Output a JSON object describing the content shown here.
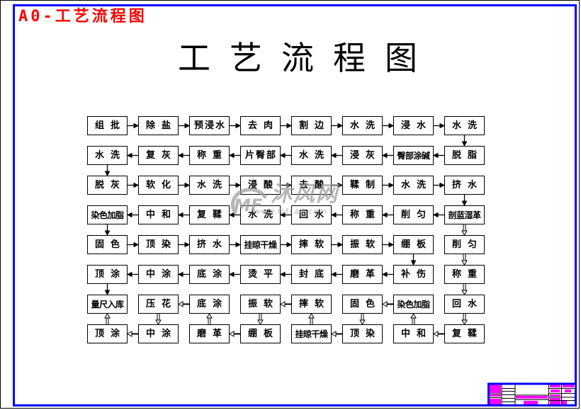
{
  "drawing": {
    "sheet_label": "A0-工艺流程图",
    "title": "工艺流程图"
  },
  "colors": {
    "frame": "#0000ff",
    "sheet_label": "#ff0000",
    "title_block_fill": "#ff00ff",
    "watermark": "#9a9a9a",
    "ink": "#000000"
  },
  "flowchart": {
    "rows": [
      [
        "组批",
        "除盐",
        "预浸水",
        "去肉",
        "割边",
        "水洗",
        "浸水",
        "水洗"
      ],
      [
        "水洗",
        "复灰",
        "称重",
        "片臀部",
        "水洗",
        "浸灰",
        "臀部涂碱",
        "脱脂"
      ],
      [
        "脱灰",
        "软化",
        "水洗",
        "浸酸",
        "去酸",
        "鞣制",
        "水洗",
        "挤水"
      ],
      [
        "染色加脂",
        "中和",
        "复鞣",
        "水洗",
        "回水",
        "称重",
        "削匀",
        "剖蓝湿革"
      ],
      [
        "固色",
        "顶染",
        "挤水",
        "挂晾干燥",
        "摔软",
        "振软",
        "绷板",
        "削匀"
      ],
      [
        "顶涂",
        "中涂",
        "底涂",
        "烫平",
        "封底",
        "磨革",
        "补伤",
        "称重"
      ],
      [
        "量尺入库",
        "压花",
        "底涂",
        "振软",
        "摔软",
        "固色",
        "染色加脂",
        "回水"
      ],
      [
        "顶涂",
        "中涂",
        "磨革",
        "绷板",
        "挂晾干燥",
        "顶染",
        "中和",
        "复鞣"
      ]
    ],
    "connections": [
      {
        "from": [
          0,
          0
        ],
        "to": [
          0,
          1
        ],
        "style": "solid"
      },
      {
        "from": [
          0,
          1
        ],
        "to": [
          0,
          2
        ],
        "style": "solid"
      },
      {
        "from": [
          0,
          2
        ],
        "to": [
          0,
          3
        ],
        "style": "solid"
      },
      {
        "from": [
          0,
          3
        ],
        "to": [
          0,
          4
        ],
        "style": "solid"
      },
      {
        "from": [
          0,
          4
        ],
        "to": [
          0,
          5
        ],
        "style": "solid"
      },
      {
        "from": [
          0,
          5
        ],
        "to": [
          0,
          6
        ],
        "style": "solid"
      },
      {
        "from": [
          0,
          6
        ],
        "to": [
          0,
          7
        ],
        "style": "solid"
      },
      {
        "from": [
          0,
          7
        ],
        "to": [
          1,
          7
        ],
        "style": "solid"
      },
      {
        "from": [
          1,
          7
        ],
        "to": [
          1,
          6
        ],
        "style": "solid"
      },
      {
        "from": [
          1,
          6
        ],
        "to": [
          1,
          5
        ],
        "style": "solid"
      },
      {
        "from": [
          1,
          5
        ],
        "to": [
          1,
          4
        ],
        "style": "solid"
      },
      {
        "from": [
          1,
          4
        ],
        "to": [
          1,
          3
        ],
        "style": "solid"
      },
      {
        "from": [
          1,
          3
        ],
        "to": [
          1,
          2
        ],
        "style": "solid"
      },
      {
        "from": [
          1,
          2
        ],
        "to": [
          1,
          1
        ],
        "style": "solid"
      },
      {
        "from": [
          1,
          1
        ],
        "to": [
          1,
          0
        ],
        "style": "solid"
      },
      {
        "from": [
          1,
          0
        ],
        "to": [
          2,
          0
        ],
        "style": "solid"
      },
      {
        "from": [
          2,
          0
        ],
        "to": [
          2,
          1
        ],
        "style": "solid"
      },
      {
        "from": [
          2,
          1
        ],
        "to": [
          2,
          2
        ],
        "style": "solid"
      },
      {
        "from": [
          2,
          2
        ],
        "to": [
          2,
          3
        ],
        "style": "solid"
      },
      {
        "from": [
          2,
          3
        ],
        "to": [
          2,
          4
        ],
        "style": "solid"
      },
      {
        "from": [
          2,
          4
        ],
        "to": [
          2,
          5
        ],
        "style": "solid"
      },
      {
        "from": [
          2,
          5
        ],
        "to": [
          2,
          6
        ],
        "style": "solid"
      },
      {
        "from": [
          2,
          6
        ],
        "to": [
          2,
          7
        ],
        "style": "solid"
      },
      {
        "from": [
          2,
          7
        ],
        "to": [
          3,
          7
        ],
        "style": "solid"
      },
      {
        "from": [
          3,
          7
        ],
        "to": [
          3,
          6
        ],
        "style": "solid"
      },
      {
        "from": [
          3,
          6
        ],
        "to": [
          3,
          5
        ],
        "style": "solid"
      },
      {
        "from": [
          3,
          5
        ],
        "to": [
          3,
          4
        ],
        "style": "solid"
      },
      {
        "from": [
          3,
          4
        ],
        "to": [
          3,
          3
        ],
        "style": "solid"
      },
      {
        "from": [
          3,
          3
        ],
        "to": [
          3,
          2
        ],
        "style": "solid"
      },
      {
        "from": [
          3,
          2
        ],
        "to": [
          3,
          1
        ],
        "style": "solid"
      },
      {
        "from": [
          3,
          1
        ],
        "to": [
          3,
          0
        ],
        "style": "solid"
      },
      {
        "from": [
          3,
          0
        ],
        "to": [
          4,
          0
        ],
        "style": "solid"
      },
      {
        "from": [
          4,
          0
        ],
        "to": [
          4,
          1
        ],
        "style": "solid"
      },
      {
        "from": [
          4,
          1
        ],
        "to": [
          4,
          2
        ],
        "style": "solid"
      },
      {
        "from": [
          4,
          2
        ],
        "to": [
          4,
          3
        ],
        "style": "solid"
      },
      {
        "from": [
          4,
          3
        ],
        "to": [
          4,
          4
        ],
        "style": "solid"
      },
      {
        "from": [
          4,
          4
        ],
        "to": [
          4,
          5
        ],
        "style": "solid"
      },
      {
        "from": [
          4,
          5
        ],
        "to": [
          4,
          6
        ],
        "style": "solid"
      },
      {
        "from": [
          4,
          6
        ],
        "to": [
          5,
          6
        ],
        "style": "solid"
      },
      {
        "from": [
          5,
          6
        ],
        "to": [
          5,
          5
        ],
        "style": "solid"
      },
      {
        "from": [
          5,
          5
        ],
        "to": [
          5,
          4
        ],
        "style": "solid"
      },
      {
        "from": [
          5,
          4
        ],
        "to": [
          5,
          3
        ],
        "style": "solid"
      },
      {
        "from": [
          5,
          3
        ],
        "to": [
          5,
          2
        ],
        "style": "solid"
      },
      {
        "from": [
          5,
          2
        ],
        "to": [
          5,
          1
        ],
        "style": "solid"
      },
      {
        "from": [
          5,
          1
        ],
        "to": [
          5,
          0
        ],
        "style": "solid"
      },
      {
        "from": [
          5,
          0
        ],
        "to": [
          6,
          0
        ],
        "style": "solid"
      },
      {
        "from": [
          3,
          7
        ],
        "to": [
          4,
          7
        ],
        "style": "hollow"
      },
      {
        "from": [
          4,
          7
        ],
        "to": [
          5,
          7
        ],
        "style": "hollow"
      },
      {
        "from": [
          5,
          7
        ],
        "to": [
          6,
          7
        ],
        "style": "hollow"
      },
      {
        "from": [
          6,
          7
        ],
        "to": [
          7,
          7
        ],
        "style": "hollow"
      },
      {
        "from": [
          7,
          7
        ],
        "to": [
          7,
          6
        ],
        "style": "hollow"
      },
      {
        "from": [
          7,
          6
        ],
        "to": [
          6,
          6
        ],
        "style": "hollow"
      },
      {
        "from": [
          6,
          6
        ],
        "to": [
          6,
          5
        ],
        "style": "hollow"
      },
      {
        "from": [
          6,
          5
        ],
        "to": [
          7,
          5
        ],
        "style": "hollow"
      },
      {
        "from": [
          7,
          5
        ],
        "to": [
          7,
          4
        ],
        "style": "hollow"
      },
      {
        "from": [
          7,
          4
        ],
        "to": [
          6,
          4
        ],
        "style": "hollow"
      },
      {
        "from": [
          6,
          4
        ],
        "to": [
          6,
          3
        ],
        "style": "hollow"
      },
      {
        "from": [
          6,
          3
        ],
        "to": [
          7,
          3
        ],
        "style": "hollow"
      },
      {
        "from": [
          7,
          3
        ],
        "to": [
          7,
          2
        ],
        "style": "hollow"
      },
      {
        "from": [
          7,
          2
        ],
        "to": [
          6,
          2
        ],
        "style": "hollow"
      },
      {
        "from": [
          6,
          2
        ],
        "to": [
          6,
          1
        ],
        "style": "hollow"
      },
      {
        "from": [
          6,
          1
        ],
        "to": [
          7,
          1
        ],
        "style": "hollow"
      },
      {
        "from": [
          7,
          1
        ],
        "to": [
          7,
          0
        ],
        "style": "hollow"
      },
      {
        "from": [
          7,
          0
        ],
        "to": [
          6,
          0
        ],
        "style": "hollow"
      }
    ]
  },
  "watermark": {
    "logo_text": "MF",
    "name": "沐风网",
    "url": "www.mfcad.com"
  }
}
